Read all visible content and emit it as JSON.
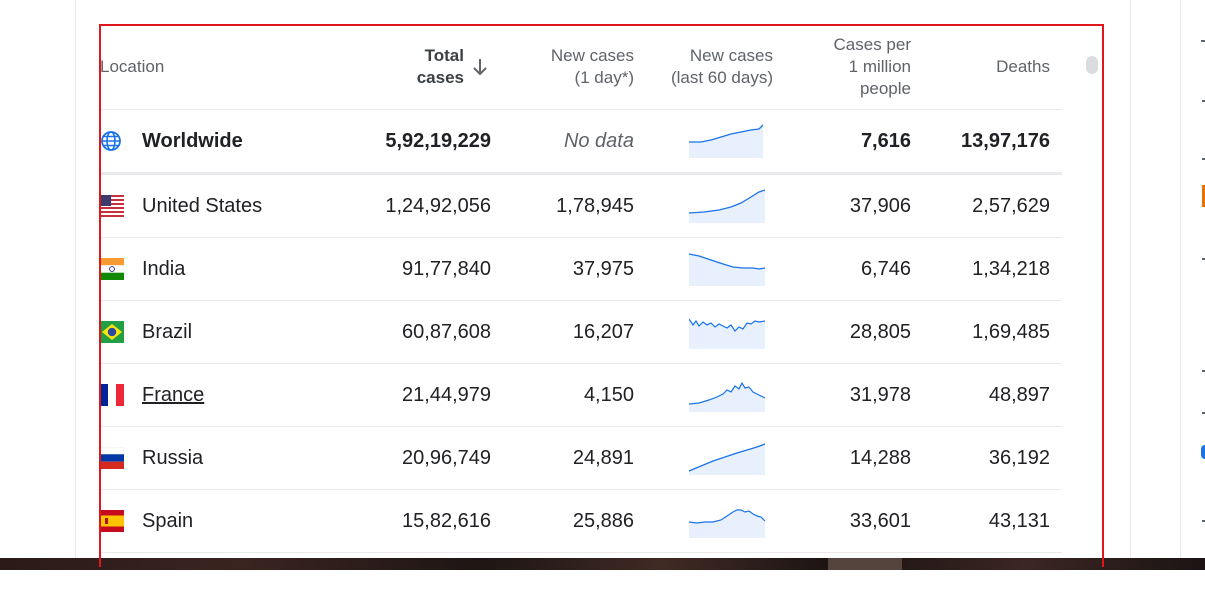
{
  "header": {
    "location": "Location",
    "total_line1": "Total",
    "total_line2": "cases",
    "new1_line1": "New cases",
    "new1_line2": "(1 day*)",
    "new60_line1": "New cases",
    "new60_line2": "(last 60 days)",
    "per_line1": "Cases per",
    "per_line2": "1 million",
    "per_line3": "people",
    "deaths": "Deaths"
  },
  "colors": {
    "accent": "#1a73e8",
    "spark_fill": "#e8f0fe",
    "highlight_border": "#e0161b"
  },
  "rows": [
    {
      "name": "Worldwide",
      "icon": "globe-icon",
      "total": "5,92,19,229",
      "new1": "No data",
      "per_million": "7,616",
      "deaths": "13,97,176"
    },
    {
      "name": "United States",
      "icon": "us-flag-icon",
      "total": "1,24,92,056",
      "new1": "1,78,945",
      "per_million": "37,906",
      "deaths": "2,57,629"
    },
    {
      "name": "India",
      "icon": "india-flag-icon",
      "total": "91,77,840",
      "new1": "37,975",
      "per_million": "6,746",
      "deaths": "1,34,218"
    },
    {
      "name": "Brazil",
      "icon": "brazil-flag-icon",
      "total": "60,87,608",
      "new1": "16,207",
      "per_million": "28,805",
      "deaths": "1,69,485"
    },
    {
      "name": "France",
      "icon": "france-flag-icon",
      "total": "21,44,979",
      "new1": "4,150",
      "per_million": "31,978",
      "deaths": "48,897"
    },
    {
      "name": "Russia",
      "icon": "russia-flag-icon",
      "total": "20,96,749",
      "new1": "24,891",
      "per_million": "14,288",
      "deaths": "36,192"
    },
    {
      "name": "Spain",
      "icon": "spain-flag-icon",
      "total": "15,82,616",
      "new1": "25,886",
      "per_million": "33,601",
      "deaths": "43,131"
    }
  ]
}
